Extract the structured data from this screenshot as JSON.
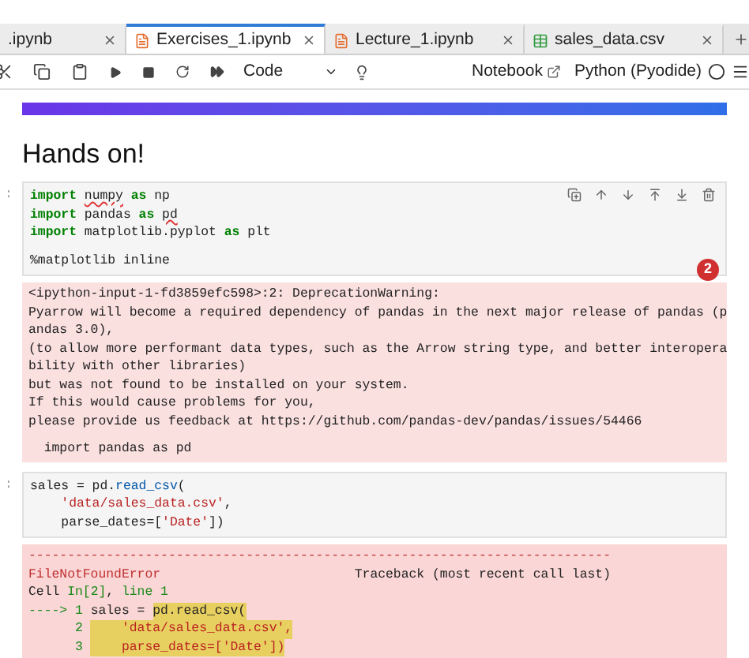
{
  "tabs": [
    {
      "label": ".ipynb",
      "kind": "plain",
      "selected": false
    },
    {
      "label": "Exercises_1.ipynb",
      "kind": "notebook",
      "selected": true
    },
    {
      "label": "Lecture_1.ipynb",
      "kind": "notebook",
      "selected": false
    },
    {
      "label": "sales_data.csv",
      "kind": "csv",
      "selected": false
    }
  ],
  "toolbar": {
    "cell_type": "Code",
    "notebook_label": "Notebook",
    "kernel": "Python (Pyodide)"
  },
  "heading": "Hands on!",
  "cells": [
    {
      "prompt": ":",
      "badge": "2",
      "show_actions": true,
      "lines": [
        {
          "blank_before": false,
          "tokens": [
            {
              "text": "import ",
              "kind": "kw"
            },
            {
              "text": "numpy",
              "kind": "squiggle"
            },
            {
              "text": " as",
              "kind": "kw"
            },
            {
              "text": " np",
              "kind": "plain"
            }
          ]
        },
        {
          "blank_before": false,
          "tokens": [
            {
              "text": "import",
              "kind": "kw"
            },
            {
              "text": " pandas ",
              "kind": "plain"
            },
            {
              "text": "as ",
              "kind": "kw"
            },
            {
              "text": "pd",
              "kind": "squiggle"
            }
          ]
        },
        {
          "blank_before": false,
          "tokens": [
            {
              "text": "import",
              "kind": "kw"
            },
            {
              "text": " matplotlib.pyplot ",
              "kind": "plain"
            },
            {
              "text": "as",
              "kind": "kw"
            },
            {
              "text": " plt",
              "kind": "plain"
            }
          ]
        },
        {
          "blank_before": true,
          "tokens": [
            {
              "text": "%matplotlib inline",
              "kind": "plain"
            }
          ]
        }
      ],
      "output": {
        "kind": "warning",
        "lines": [
          {
            "blank_before": false,
            "tokens": [
              {
                "text": "<ipython-input-1-fd3859efc598>:2: DeprecationWarning:",
                "kind": "plain"
              }
            ]
          },
          {
            "blank_before": false,
            "tokens": [
              {
                "text": "Pyarrow will become a required dependency of pandas in the next major release of pandas (p",
                "kind": "plain"
              }
            ]
          },
          {
            "blank_before": false,
            "tokens": [
              {
                "text": "andas 3.0),",
                "kind": "plain"
              }
            ]
          },
          {
            "blank_before": false,
            "tokens": [
              {
                "text": "(to allow more performant data types, such as the Arrow string type, and better interopera",
                "kind": "plain"
              }
            ]
          },
          {
            "blank_before": false,
            "tokens": [
              {
                "text": "bility with other libraries)",
                "kind": "plain"
              }
            ]
          },
          {
            "blank_before": false,
            "tokens": [
              {
                "text": "but was not found to be installed on your system.",
                "kind": "plain"
              }
            ]
          },
          {
            "blank_before": false,
            "tokens": [
              {
                "text": "If this would cause problems for you,",
                "kind": "plain"
              }
            ]
          },
          {
            "blank_before": false,
            "tokens": [
              {
                "text": "please provide us feedback at https://github.com/pandas-dev/pandas/issues/54466",
                "kind": "plain"
              }
            ]
          },
          {
            "blank_before": true,
            "tokens": [
              {
                "text": "  import pandas as pd",
                "kind": "plain"
              }
            ]
          }
        ]
      }
    },
    {
      "prompt": ":",
      "show_actions": false,
      "lines": [
        {
          "blank_before": false,
          "tokens": [
            {
              "text": "sales = pd.",
              "kind": "plain"
            },
            {
              "text": "read_csv",
              "kind": "fn"
            },
            {
              "text": "(",
              "kind": "plain"
            }
          ]
        },
        {
          "blank_before": false,
          "tokens": [
            {
              "text": "    'data/sales_data.csv'",
              "kind": "str"
            },
            {
              "text": ",",
              "kind": "plain"
            }
          ]
        },
        {
          "blank_before": false,
          "tokens": [
            {
              "text": "    parse_dates=[",
              "kind": "plain"
            },
            {
              "text": "'Date'",
              "kind": "str"
            },
            {
              "text": "])",
              "kind": "plain"
            }
          ]
        }
      ],
      "output": {
        "kind": "error",
        "lines": [
          {
            "blank_before": false,
            "tokens": [
              {
                "text": "---------------------------------------------------------------------------",
                "kind": "err"
              }
            ]
          },
          {
            "blank_before": false,
            "tokens": [
              {
                "text": "FileNotFoundError",
                "kind": "err"
              },
              {
                "text": "                         Traceback (most recent call last)",
                "kind": "plain"
              }
            ]
          },
          {
            "blank_before": false,
            "tokens": [
              {
                "text": "Cell ",
                "kind": "plain"
              },
              {
                "text": "In[2]",
                "kind": "lineno"
              },
              {
                "text": ", ",
                "kind": "plain"
              },
              {
                "text": "line 1",
                "kind": "lineno"
              }
            ]
          },
          {
            "blank_before": false,
            "tokens": [
              {
                "text": "----> 1 ",
                "kind": "lineno"
              },
              {
                "text": "sales = ",
                "kind": "plain"
              },
              {
                "text": "pd.read_csv(",
                "kind": "hl"
              }
            ]
          },
          {
            "blank_before": false,
            "tokens": [
              {
                "text": "      2 ",
                "kind": "lineno"
              },
              {
                "text": "    'data/sales_data.csv',",
                "kind": "hlstr"
              }
            ]
          },
          {
            "blank_before": false,
            "tokens": [
              {
                "text": "      3 ",
                "kind": "lineno"
              },
              {
                "text": "    parse_dates=['Date'])",
                "kind": "hlstr"
              }
            ]
          }
        ]
      }
    }
  ]
}
